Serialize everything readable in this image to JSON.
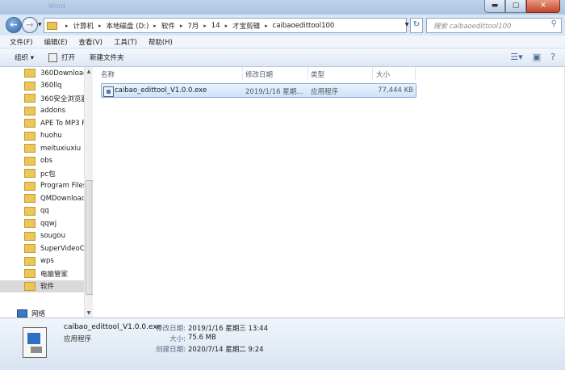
{
  "window": {
    "title": "Word"
  },
  "address": {
    "crumbs": [
      "计算机",
      "本地磁盘 (D:)",
      "软件",
      "7月",
      "14",
      "才宝剪辑",
      "caibaoedittool100"
    ],
    "search_placeholder": "搜索 caibaoedittool100"
  },
  "menu": {
    "items": [
      "文件(F)",
      "编辑(E)",
      "查看(V)",
      "工具(T)",
      "帮助(H)"
    ]
  },
  "toolbar": {
    "organize": "组织 ▾",
    "open": "打开",
    "new_folder": "新建文件夹"
  },
  "nav": {
    "items": [
      "360Download",
      "360llq",
      "360安全浏览器",
      "addons",
      "APE To MP3 F",
      "huohu",
      "meituxiuxiu",
      "obs",
      "pc包",
      "Program Files",
      "QMDownload",
      "qq",
      "qqwj",
      "sougou",
      "SuperVideoCa",
      "wps",
      "电脑管家",
      "软件"
    ],
    "selected": "软件",
    "network": "网络"
  },
  "columns": {
    "name": "名称",
    "date": "修改日期",
    "type": "类型",
    "size": "大小"
  },
  "files": [
    {
      "name": "caibao_edittool_V1.0.0.exe",
      "date": "2019/1/16 星期...",
      "type": "应用程序",
      "size": "77,444 KB"
    }
  ],
  "details": {
    "name": "caibao_edittool_V1.0.0.exe",
    "type": "应用程序",
    "modified_label": "修改日期:",
    "modified": "2019/1/16 星期三 13:44",
    "size_label": "大小:",
    "size": "75.6 MB",
    "created_label": "创建日期:",
    "created": "2020/7/14 星期二 9:24"
  }
}
